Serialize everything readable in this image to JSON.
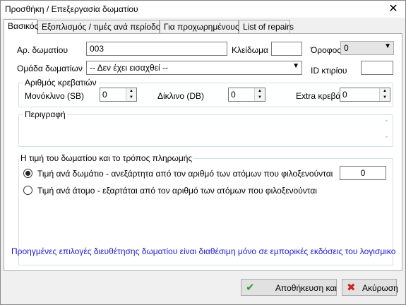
{
  "window": {
    "title": "Προσθήκη / Επεξεργασία δωματίου",
    "close_glyph": "✕"
  },
  "tabs": [
    {
      "label": "Βασικός"
    },
    {
      "label": "Εξοπλισμός / τιμές ανά περίοδο"
    },
    {
      "label": "Για προχωρημένους"
    },
    {
      "label": "List of repairs"
    }
  ],
  "form": {
    "room_no_label": "Αρ. δωματίου",
    "room_no_value": "003",
    "lock_id_label": "Κλείδωμα ID",
    "lock_id_value": "",
    "floor_label": "Όροφος",
    "floor_value": "0",
    "room_group_label": "Ομάδα δωματίων",
    "room_group_value": "-- Δεν έχει εισαχθεί --",
    "building_id_label": "ID κτιρίου",
    "building_id_value": ""
  },
  "beds": {
    "group_title": "Αριθμός κρεβατιών",
    "single_label": "Μονόκλινο (SB)",
    "single_value": "0",
    "double_label": "Δίκλινο (DB)",
    "double_value": "0",
    "extra_label": "Extra κρεβάτ",
    "extra_value": "0"
  },
  "description": {
    "group_title": "Περιγραφή",
    "value": ""
  },
  "pricing": {
    "group_title": "Η τιμή του δωματίου και το τρόπος πληρωμής",
    "per_room_label": "Τιμή ανά δωμάτιο - ανεξάρτητα από τον αριθμό των ατόμων που φιλοξενούνται",
    "per_room_selected": true,
    "price_value": "0",
    "per_person_label": "Τιμή ανά άτομο - εξαρτάται από τον αριθμό των ατόμων που φιλοξενούνται",
    "per_person_selected": false
  },
  "info_text": "Προηγμένες επιλογές διευθέτησης δωματίου είναι διαθέσιμη μόνο σε εμπορικές εκδόσεις του λογισμικο",
  "buttons": {
    "save_label": "Αποθήκευση και",
    "cancel_label": "Ακύρωση"
  },
  "colors": {
    "info_text": "#1b1bc8",
    "save_icon": "#2e9e2e",
    "cancel_icon": "#d42020"
  }
}
